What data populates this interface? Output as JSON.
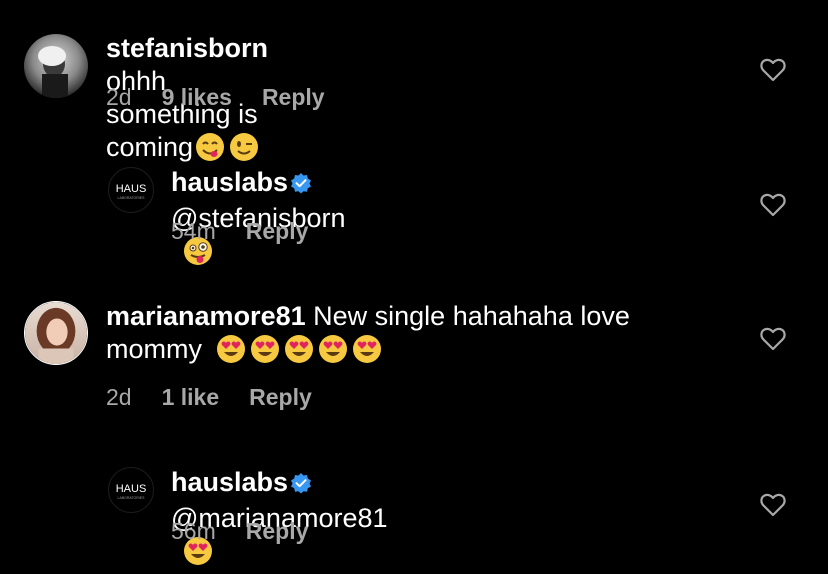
{
  "comments": [
    {
      "username": "stefanisborn",
      "text": "ohhh something is coming",
      "emojis": [
        "savoring-face",
        "winking-face"
      ],
      "time": "2d",
      "likes": "9 likes",
      "reply": "Reply"
    },
    {
      "username": "hauslabs",
      "verified": true,
      "text": "@stefanisborn",
      "emojis": [
        "zany-face"
      ],
      "time": "54m",
      "reply": "Reply",
      "avatar_text": "HAUS",
      "avatar_subtext": "LABORATORIES"
    },
    {
      "username": "marianamore81",
      "text_line1": "New single hahahaha love",
      "text_line2": "mommy",
      "emojis": [
        "heart-eyes-face",
        "heart-eyes-face",
        "heart-eyes-face",
        "heart-eyes-face",
        "heart-eyes-face"
      ],
      "time": "2d",
      "likes": "1 like",
      "reply": "Reply"
    },
    {
      "username": "hauslabs",
      "verified": true,
      "text": "@marianamore81",
      "emojis": [
        "heart-eyes-face"
      ],
      "time": "56m",
      "reply": "Reply",
      "avatar_text": "HAUS",
      "avatar_subtext": "LABORATORIES"
    }
  ],
  "colors": {
    "background": "#000000",
    "text": "#ffffff",
    "meta": "#a8a8a8",
    "verified": "#3897f0",
    "emoji_yellow": "#f7c940",
    "heart_red": "#e0245e"
  }
}
